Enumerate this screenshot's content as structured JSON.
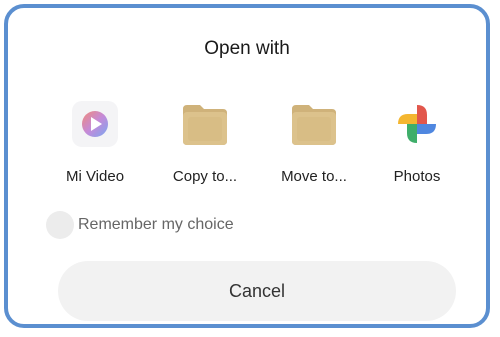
{
  "dialog": {
    "title": "Open with",
    "apps": [
      {
        "label": "Mi Video",
        "icon": "mi-video-icon"
      },
      {
        "label": "Copy to...",
        "icon": "folder-icon"
      },
      {
        "label": "Move to...",
        "icon": "folder-icon"
      },
      {
        "label": "Photos",
        "icon": "photos-pinwheel-icon"
      }
    ],
    "remember_label": "Remember my choice",
    "remember_checked": false,
    "cancel_label": "Cancel"
  },
  "colors": {
    "frame_border": "#5b8fd0",
    "folder": "#d9be85",
    "cancel_bg": "#f2f2f2"
  }
}
